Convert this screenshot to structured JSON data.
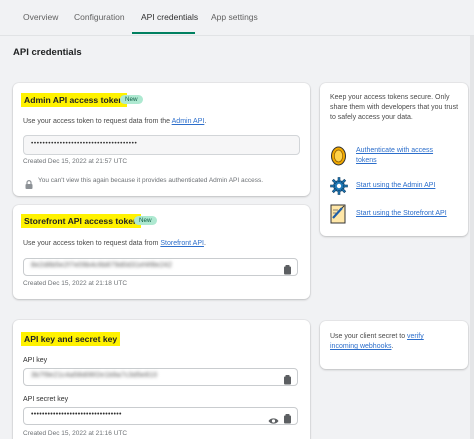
{
  "tabs": [
    {
      "label": "Overview"
    },
    {
      "label": "Configuration"
    },
    {
      "label": "API credentials"
    },
    {
      "label": "App settings"
    }
  ],
  "page_title": "API credentials",
  "admin": {
    "title": "Admin API access token",
    "badge": "New",
    "desc_prefix": "Use your access token to request data from the ",
    "desc_link": "Admin API",
    "desc_suffix": ".",
    "token_masked": "•••••••••••••••••••••••••••••••••••••",
    "created": "Created Dec 15, 2022 at 21:57 UTC",
    "warning": "You can't view this again because it provides authenticated Admin API access."
  },
  "storefront": {
    "title": "Storefront API access token",
    "badge": "New",
    "desc_prefix": "Use your access token to request data from ",
    "desc_link": "Storefront API",
    "desc_suffix": ".",
    "token_value": "8e2d8b5e2f7e09b4c6b879d0d31ef4f8e242",
    "created": "Created Dec 15, 2022 at 21:18 UTC"
  },
  "keys": {
    "title": "API key and secret key",
    "api_key_label": "API key",
    "api_key_value": "3b7f9e21c4a58d06f2e1b9a7c3d5e810",
    "secret_label": "API secret key",
    "secret_masked": "•••••••••••••••••••••••••••••••••",
    "created": "Created Dec 15, 2022 at 21:16 UTC"
  },
  "side_tokens": {
    "text": "Keep your access tokens secure. Only share them with developers that you trust to safely access your data.",
    "items": [
      {
        "label_line1": "Authenticate with access",
        "label_line2": "tokens",
        "icon": "token-coin-icon"
      },
      {
        "label_line1": "Start using the Admin API",
        "label_line2": "",
        "icon": "gear-icon"
      },
      {
        "label_line1": "Start using the Storefront API",
        "label_line2": "",
        "icon": "storefront-doc-icon"
      }
    ]
  },
  "side_secret": {
    "prefix": "Use your client secret to ",
    "link1": "verify",
    "link2": "incoming webhooks",
    "suffix": "."
  },
  "colors": {
    "accent": "#008060",
    "highlight": "#fff200",
    "link": "#2c6ecb",
    "badge_bg": "#aee9d1"
  }
}
